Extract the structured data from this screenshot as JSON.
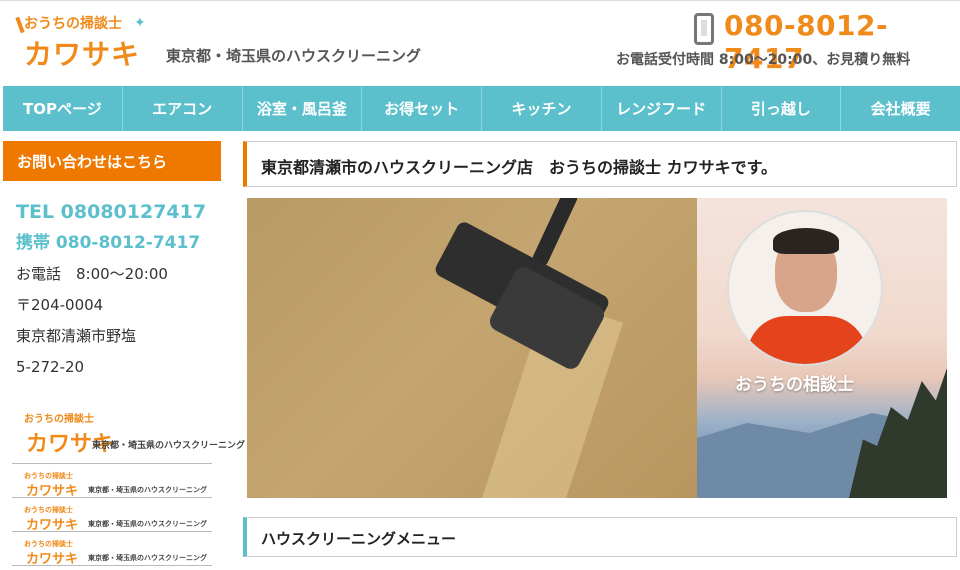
{
  "header": {
    "logo_small": "おうちの掃談士",
    "logo_big": "カワサキ",
    "tagline": "東京都・埼玉県のハウスクリーニング",
    "phone": "080-8012-7417",
    "hours_note": "お電話受付時間 8:00～20:00、お見積り無料"
  },
  "nav": {
    "items": [
      {
        "label": "TOPページ"
      },
      {
        "label": "エアコン"
      },
      {
        "label": "浴室・風呂釜"
      },
      {
        "label": "お得セット"
      },
      {
        "label": "キッチン"
      },
      {
        "label": "レンジフード"
      },
      {
        "label": "引っ越し"
      },
      {
        "label": "会社概要"
      }
    ]
  },
  "sidebar": {
    "contact_heading": "お問い合わせはこちら",
    "tel": "TEL 08080127417",
    "mobile": "携帯 080-8012-7417",
    "phone_hours": "お電話　8:00～20:00",
    "postal": "〒204-0004",
    "address1": "東京都清瀬市野塩",
    "address2": "5-272-20",
    "banner_small": "おうちの掃談士",
    "banner_big": "カワサキ",
    "banner_tag": "東京都・埼玉県のハウスクリーニング"
  },
  "main": {
    "title": "東京都清瀬市のハウスクリーニング店　おうちの掃談士 カワサキです。",
    "hero_caption": "おうちの相談士",
    "menu_heading": "ハウスクリーニングメニュー"
  },
  "colors": {
    "accent_orange": "#ee7800",
    "accent_teal": "#5bc0cc"
  }
}
